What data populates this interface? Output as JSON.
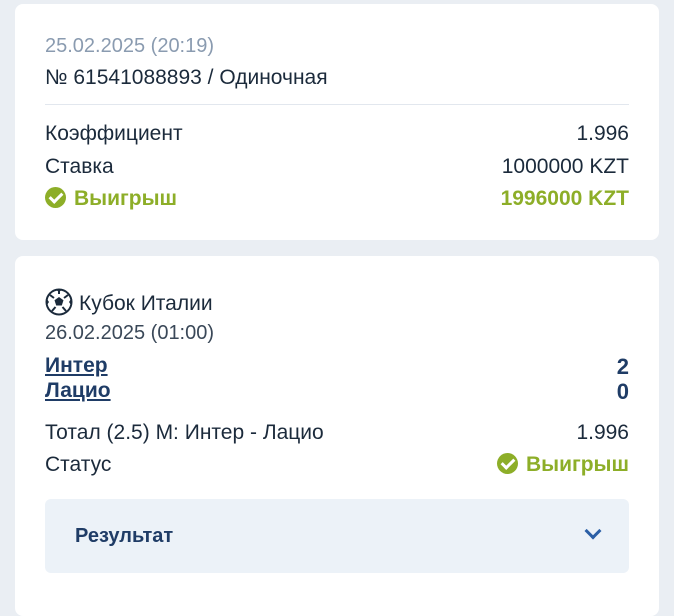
{
  "bet": {
    "datetime": "25.02.2025 (20:19)",
    "number": "№ 61541088893 / Одиночная",
    "coefficient_label": "Коэффициент",
    "coefficient_value": "1.996",
    "stake_label": "Ставка",
    "stake_value": "1000000 KZT",
    "win_label": "Выигрыш",
    "win_value": "1996000 KZT",
    "colors": {
      "win": "#8dae28"
    }
  },
  "event": {
    "sport_icon": "soccer-ball-icon",
    "tournament": "Кубок Италии",
    "datetime": "26.02.2025 (01:00)",
    "teams": [
      {
        "name": "Интер",
        "score": "2"
      },
      {
        "name": "Лацио",
        "score": "0"
      }
    ],
    "market": "Тотал (2.5) М: Интер - Лацио",
    "market_odds": "1.996",
    "status_label": "Статус",
    "status_value": "Выигрыш",
    "result_label": "Результат"
  }
}
